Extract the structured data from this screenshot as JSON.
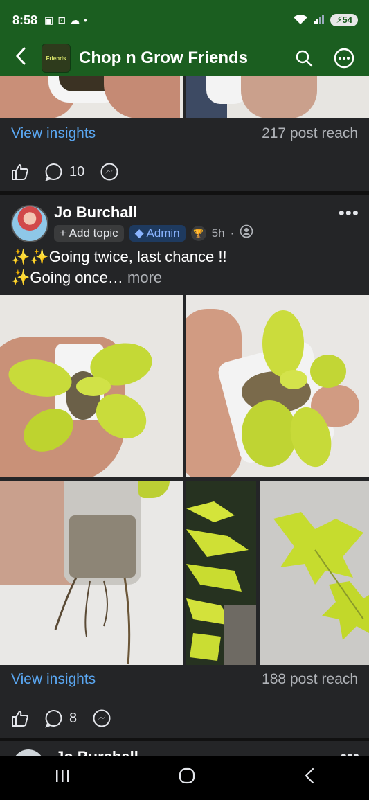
{
  "status_bar": {
    "time": "8:58",
    "battery": "54"
  },
  "header": {
    "back_icon": "back-arrow-icon",
    "group_name": "Chop n Grow Friends",
    "logo_text": "Friends"
  },
  "post1": {
    "view_insights": "View insights",
    "reach": "217 post reach",
    "comments_count": "10"
  },
  "post2": {
    "author": "Jo Burchall",
    "add_topic": "+ Add topic",
    "admin_badge": "Admin",
    "time": "5h",
    "text_line1": "✨✨Going twice, last chance !!",
    "text_line2": "✨Going once…",
    "more": "more",
    "view_insights": "View insights",
    "reach": "188 post reach",
    "comments_count": "8"
  },
  "next_post": {
    "author": "Jo Burchall"
  },
  "colors": {
    "header_bg": "#1b5e20",
    "link": "#5aa7f2",
    "feed_bg": "#242527"
  }
}
